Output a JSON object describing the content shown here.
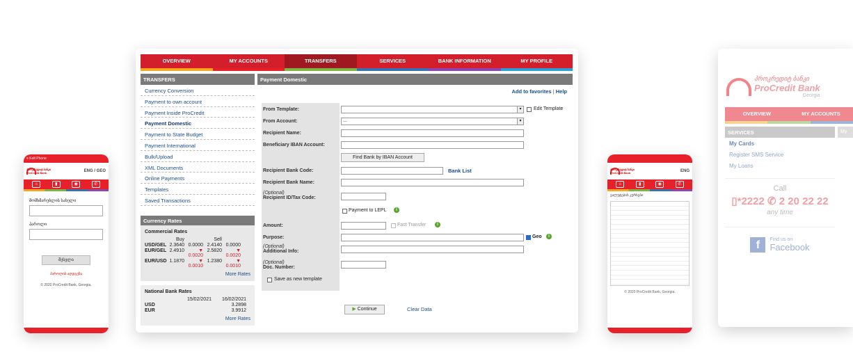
{
  "phone_left": {
    "status": "≡ Kolt Phone",
    "lang": "ENG / GEO",
    "brand_geo": "პროკრედიტ ბანკი",
    "brand": "ProCredit Bank",
    "username_label": "მომხმარებლის სახელი",
    "password_label": "პაროლი",
    "login_btn": "შესვლა",
    "forgot_link": "პაროლის აღდგენა",
    "copyright": "© 2020 ProCredit Bank, Georgia."
  },
  "nav": {
    "items": [
      "OVERVIEW",
      "MY ACCOUNTS",
      "TRANSFERS",
      "SERVICES",
      "BANK INFORMATION",
      "MY PROFILE"
    ],
    "bar_colors": [
      "#f5a623",
      "#e8202a",
      "#7cb342",
      "#3a6fb0",
      "#8e44ad",
      "#2a9fd6"
    ]
  },
  "sidebar": {
    "header": "TRANSFERS",
    "items": [
      "Currency Conversion",
      "Payment to own account",
      "Payment Inside ProCredit",
      "Payment Domestic",
      "Payment to State Budget",
      "Payment International",
      "Bulk/Upload",
      "XML Documents",
      "Online Payments",
      "Templates",
      "Saved Transactions"
    ],
    "active_index": 3
  },
  "rates": {
    "header": "Currency Rates",
    "commercial_title": "Commercial Rates",
    "buy": "Buy",
    "sell": "Sell",
    "rows": [
      {
        "pair": "USD/GEL",
        "buy": "2.3640",
        "buy_ch": "0.0000",
        "sell": "2.4140",
        "sell_ch": "0.0000",
        "down": false
      },
      {
        "pair": "EUR/GEL",
        "buy": "2.4910",
        "buy_ch": "0.0020",
        "sell": "2.5820",
        "sell_ch": "0.0020",
        "down": true
      },
      {
        "pair": "EUR/USD",
        "buy": "1.1870",
        "buy_ch": "0.0010",
        "sell": "1.2380",
        "sell_ch": "0.0010",
        "down": true
      }
    ],
    "more": "More Rates",
    "national_title": "National Bank Rates",
    "date1": "15/02/2021",
    "date2": "16/02/2021",
    "national_rows": [
      {
        "cur": "USD",
        "val": "3.2898"
      },
      {
        "cur": "EUR",
        "val": "3.9912"
      }
    ],
    "more2": "More Rates"
  },
  "content": {
    "header": "Payment Domestic",
    "add_fav": "Add to favorites",
    "help": "Help",
    "from_template": "From Template:",
    "edit_template": "Edit Template",
    "from_account": "From Account:",
    "from_account_value": "...",
    "recipient_name": "Recipient Name:",
    "beneficiary_iban": "Beneficiary IBAN Account:",
    "find_bank_btn": "Find Bank by IBAN Account",
    "recipient_bank_code": "Recipient Bank Code:",
    "bank_list": "Bank List",
    "recipient_bank_name": "Recipient Bank Name:",
    "optional": "(Optional)",
    "recipient_id": "Recipient ID/Tax Code:",
    "payment_lepl": "Payment to LEPL",
    "amount": "Amount:",
    "fast_transfer": "Fast Transfer",
    "purpose": "Purpose:",
    "geo": "Geo",
    "additional_info": "Additional Info:",
    "doc_number": "Doc. Number:",
    "save_template": "Save as new template",
    "continue_btn": "Continue",
    "clear_data": "Clear Data"
  },
  "phone_right": {
    "lang": "ENG",
    "title": "ვალუტების კურსები",
    "copyright": "© 2020 ProCredit Bank, Georgia."
  },
  "far_right": {
    "brand_geo": "პროკრედიტ ბანკი",
    "brand": "ProCredit Bank",
    "country": "Georgia",
    "nav": [
      "OVERVIEW",
      "MY ACCOUNTS"
    ],
    "side_header": "SERVICES",
    "side_right": "My",
    "items": [
      "My Cards",
      "Register SMS Service",
      "My Loans"
    ],
    "call": "Call",
    "short_number": "*2222",
    "long_number": "2 20 22 22",
    "any_time": "any time",
    "find_us": "Find us on",
    "facebook": "Facebook"
  }
}
